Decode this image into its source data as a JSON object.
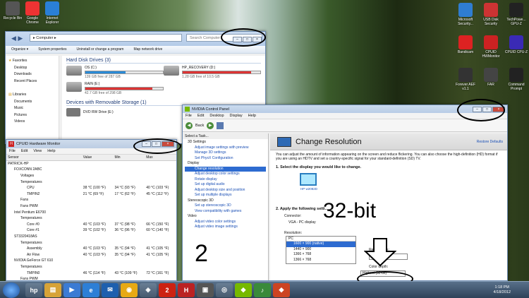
{
  "desktop": {
    "left": [
      "Recycle Bin",
      "Google Chrome",
      "Internet Explorer"
    ],
    "right": [
      [
        "Microsoft Security...",
        "USB Disk Security",
        "TechPowe... GPU-Z"
      ],
      [
        "Bandicam",
        "CPUID HWMonitor",
        "CPUID CPU-Z"
      ],
      [
        "Forever AEF v1.1",
        "FAR",
        "Command Prompt"
      ]
    ]
  },
  "explorer": {
    "address": "▸ Computer ▸",
    "search": "Search Computer",
    "toolbar": [
      "Organize ▾",
      "System properties",
      "Uninstall or change a program",
      "Map network drive"
    ],
    "nav": [
      {
        "t": "Favorites",
        "ico": "★"
      },
      {
        "t": "Desktop"
      },
      {
        "t": "Downloads"
      },
      {
        "t": "Recent Places"
      },
      {
        "t": ""
      },
      {
        "t": "Libraries",
        "ico": "▤"
      },
      {
        "t": "Documents"
      },
      {
        "t": "Music"
      },
      {
        "t": "Pictures"
      },
      {
        "t": "Videos"
      }
    ],
    "hdd_header": "Hard Disk Drives (3)",
    "drives": [
      {
        "name": "OS (C:)",
        "free": "139 GB free of 287 GB",
        "fill": 0.52
      },
      {
        "name": "HP_RECOVERY (D:)",
        "free": "1.28 GB free of 10.5 GB",
        "fill": 0.88
      },
      {
        "name": "RAIN (E:)",
        "free": "42.7 GB free of 298 GB",
        "fill": 0.86
      }
    ],
    "rem_header": "Devices with Removable Storage (1)",
    "dvd": "DVD RW Drive (E:)"
  },
  "hwmon": {
    "title": "CPUID Hardware Monitor",
    "menu": [
      "File",
      "Edit",
      "View",
      "Help"
    ],
    "cols": [
      "Sensor",
      "Value",
      "Min",
      "Max"
    ],
    "rows": [
      [
        "PATRICK-HP",
        "",
        "",
        ""
      ],
      [
        "FOXCONN 2ABC",
        "",
        "",
        ""
      ],
      [
        "Voltages",
        "",
        "",
        ""
      ],
      [
        "Temperatures",
        "",
        "",
        ""
      ],
      [
        "CPU",
        "38 °C (100 °F)",
        "34 °C (93 °F)",
        "40 °C (103 °F)"
      ],
      [
        "TMPIN2",
        "21 °C (69 °F)",
        "17 °C (62 °F)",
        "45 °C (112 °F)"
      ],
      [
        "Fans",
        "",
        "",
        ""
      ],
      [
        "Fans PWM",
        "",
        "",
        ""
      ],
      [
        "Intel Pentium E6700",
        "",
        "",
        ""
      ],
      [
        "Temperatures",
        "",
        "",
        ""
      ],
      [
        "Core #0",
        "40 °C (103 °F)",
        "37 °C (98 °F)",
        "66 °C (150 °F)"
      ],
      [
        "Core #1",
        "39 °C (102 °F)",
        "36 °C (96 °F)",
        "60 °C (140 °F)"
      ],
      [
        "ST3320418AS",
        "",
        "",
        ""
      ],
      [
        "Temperatures",
        "",
        "",
        ""
      ],
      [
        "Assembly",
        "40 °C (103 °F)",
        "35 °C (94 °F)",
        "41 °C (105 °F)"
      ],
      [
        "Air Flow",
        "40 °C (103 °F)",
        "35 °C (94 °F)",
        "41 °C (105 °F)"
      ],
      [
        "NVIDIA GeForce GT 610",
        "",
        "",
        ""
      ],
      [
        "Temperatures",
        "",
        "",
        ""
      ],
      [
        "TMPIN0",
        "46 °C (114 °F)",
        "43 °C (109 °F)",
        "72 °C (161 °F)"
      ],
      [
        "Fans PWM",
        "",
        "",
        ""
      ]
    ]
  },
  "nvidia": {
    "title": "NVIDIA Control Panel",
    "menu": [
      "File",
      "Edit",
      "Desktop",
      "Display",
      "Help"
    ],
    "back": "Back",
    "task": "Select a Task...",
    "tree": [
      {
        "t": "3D Settings",
        "l": 0
      },
      {
        "t": "Adjust image settings with preview",
        "l": 1
      },
      {
        "t": "Manage 3D settings",
        "l": 1
      },
      {
        "t": "Set PhysX Configuration",
        "l": 1
      },
      {
        "t": "Display",
        "l": 0
      },
      {
        "t": "Change resolution",
        "l": 1,
        "sel": true
      },
      {
        "t": "Adjust desktop color settings",
        "l": 1
      },
      {
        "t": "Rotate display",
        "l": 1
      },
      {
        "t": "Set up digital audio",
        "l": 1
      },
      {
        "t": "Adjust desktop size and position",
        "l": 1
      },
      {
        "t": "Set up multiple displays",
        "l": 1
      },
      {
        "t": "Stereoscopic 3D",
        "l": 0
      },
      {
        "t": "Set up stereoscopic 3D",
        "l": 1
      },
      {
        "t": "View compatibility with games",
        "l": 1
      },
      {
        "t": "Video",
        "l": 0
      },
      {
        "t": "Adjust video color settings",
        "l": 1
      },
      {
        "t": "Adjust video image settings",
        "l": 1
      }
    ],
    "heading": "Change Resolution",
    "restore": "Restore Defaults",
    "desc": "You can adjust the amount of information appearing on the screen and reduce flickering. You can also choose the high-definition (HD) format if you are using an HDTV and set a country-specific signal for your standard-definition (SD) TV.",
    "step1": "1. Select the display you would like to change.",
    "monitor": "HP w2082D",
    "step2": "2. Apply the following setti...",
    "connector_label": "Connector:",
    "connector": "VGA - PC display",
    "res_label": "Resolution:",
    "res_group": "PC",
    "res_items": [
      "1600 × 900 (native)",
      "1440 × 900",
      "1366 × 768",
      "1366 × 768"
    ],
    "refresh_label": "Refresh rate:",
    "refresh": "60Hz",
    "depth_label": "Color depth:",
    "depth": "Highest (32-bit)"
  },
  "annotations": {
    "bits": "32-bit",
    "two": "2"
  },
  "clock": {
    "time": "1:18 PM",
    "date": "4/18/2012"
  }
}
